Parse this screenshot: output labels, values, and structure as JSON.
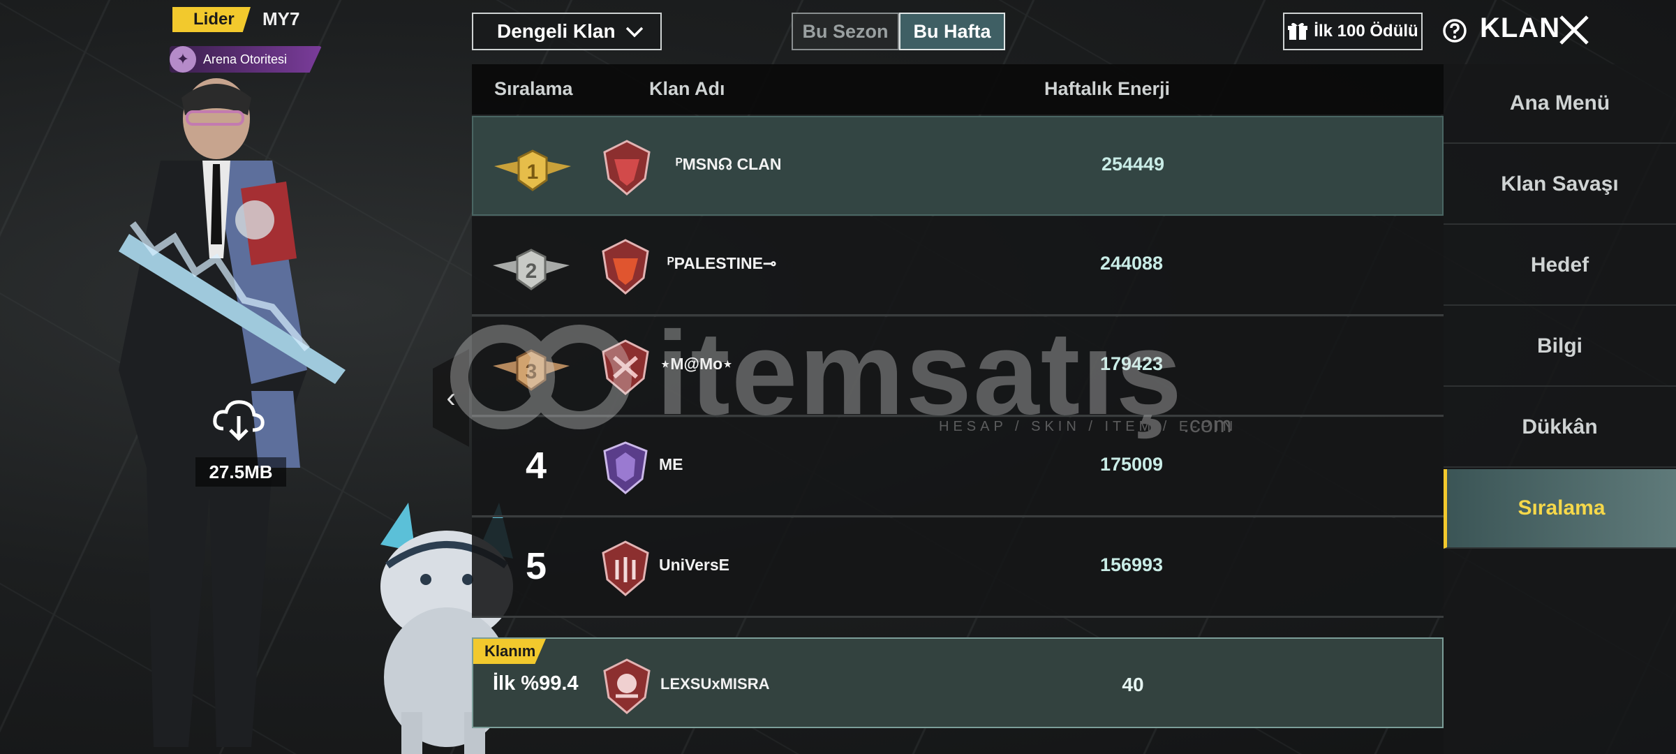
{
  "player": {
    "role_badge": "Lider",
    "name": "MY7",
    "title": "Arena Otoritesi",
    "download_size": "27.5MB"
  },
  "controls": {
    "dropdown_value": "Dengeli Klan",
    "tabs": [
      {
        "label": "Bu Sezon",
        "active": false
      },
      {
        "label": "Bu Hafta",
        "active": true
      }
    ],
    "reward_button": "İlk 100 Ödülü",
    "screen_title": "KLAN"
  },
  "table": {
    "headers": {
      "rank": "Sıralama",
      "clan": "Klan Adı",
      "energy": "Haftalık Enerji"
    },
    "rows": [
      {
        "rank": "1",
        "name": "ᴾMSN☊ CLAN",
        "energy": "254449"
      },
      {
        "rank": "2",
        "name": "ᴾPALESTINE⊸",
        "energy": "244088"
      },
      {
        "rank": "3",
        "name": "⋆M@Mo⋆",
        "energy": "179423"
      },
      {
        "rank": "4",
        "name": "ME",
        "energy": "175009"
      },
      {
        "rank": "5",
        "name": "UniVersE",
        "energy": "156993"
      }
    ],
    "my_clan": {
      "tag": "Klanım",
      "rank": "İlk %99.4",
      "name": "LEXSUxMISRA",
      "energy": "40"
    }
  },
  "menu": {
    "items": [
      {
        "label": "Ana Menü",
        "active": false
      },
      {
        "label": "Klan Savaşı",
        "active": false
      },
      {
        "label": "Hedef",
        "active": false
      },
      {
        "label": "Bilgi",
        "active": false
      },
      {
        "label": "Dükkân",
        "active": false
      },
      {
        "label": "Sıralama",
        "active": true
      }
    ]
  },
  "watermark": {
    "brand": "itemsatış",
    "tagline": "HESAP / SKIN / ITEM / E-PIN",
    "suffix": ".com"
  },
  "colors": {
    "accent_yellow": "#f2c92d",
    "active_tab": "#3f5f64",
    "energy_text": "#c9ece6"
  },
  "icons": [
    "gift-icon",
    "help-icon",
    "close-icon",
    "chevron-down-icon",
    "download-cloud-icon",
    "chevron-left-icon",
    "gold-medal-icon",
    "silver-medal-icon",
    "bronze-medal-icon"
  ]
}
